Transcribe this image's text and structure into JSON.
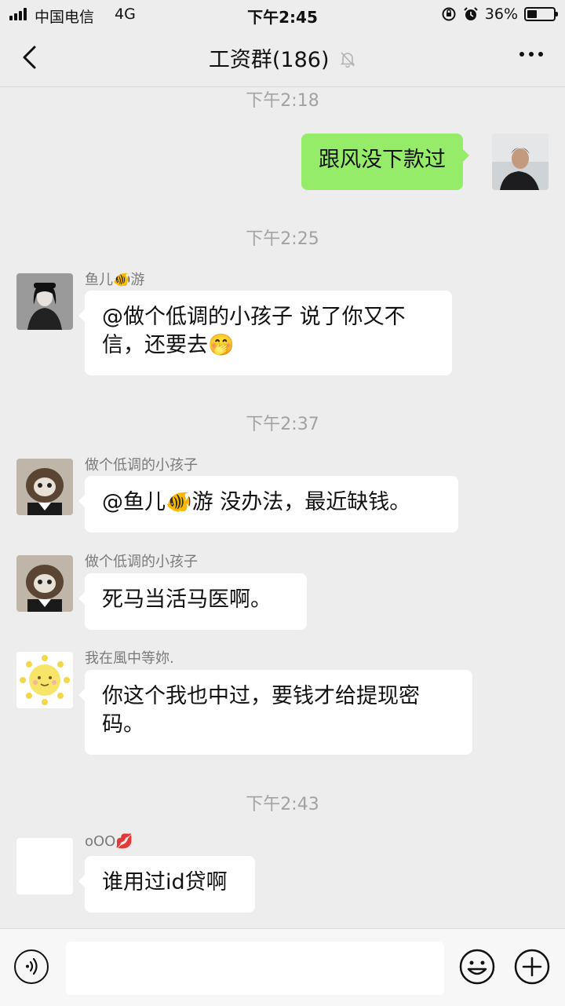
{
  "status_bar": {
    "carrier": "中国电信",
    "network": "4G",
    "time": "下午2:45",
    "battery_percent_label": "36%",
    "battery_level": 0.36
  },
  "header": {
    "title": "工资群(186)",
    "muted": true
  },
  "messages": [
    {
      "type": "time",
      "text": "下午2:18"
    },
    {
      "type": "mine",
      "text": "跟风没下款过"
    },
    {
      "type": "time",
      "text": "下午2:25"
    },
    {
      "type": "other",
      "sender": "鱼儿🐠游",
      "lines": [
        "@做个低调的小孩子 说了你又不",
        "信，还要去🤭"
      ]
    },
    {
      "type": "time",
      "text": "下午2:37"
    },
    {
      "type": "other",
      "sender": "做个低调的小孩子",
      "lines": [
        "@鱼儿🐠游 没办法，最近缺钱。"
      ]
    },
    {
      "type": "other",
      "sender": "做个低调的小孩子",
      "lines": [
        "死马当活马医啊。"
      ]
    },
    {
      "type": "other",
      "sender": "我在風中等妳.",
      "lines": [
        "你这个我也中过，要钱才给提现密",
        "码。"
      ]
    },
    {
      "type": "time",
      "text": "下午2:43"
    },
    {
      "type": "other",
      "sender": "oOO💋",
      "lines": [
        "谁用过id贷啊"
      ]
    }
  ],
  "input_bar": {
    "placeholder": ""
  },
  "colors": {
    "background": "#ededed",
    "my_bubble": "#95ec69",
    "other_bubble": "#ffffff",
    "timestamp": "#a2a2a2"
  }
}
